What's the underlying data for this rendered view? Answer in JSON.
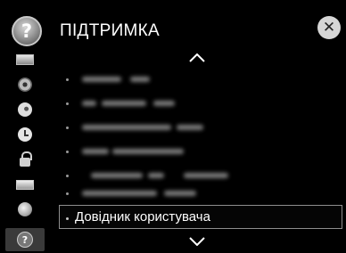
{
  "header": {
    "title": "ПІДТРИМКА",
    "support_glyph": "?",
    "close_glyph": "✕"
  },
  "sidebar": {
    "items": [
      {
        "icon": "picture-icon"
      },
      {
        "icon": "sound-icon"
      },
      {
        "icon": "channel-icon"
      },
      {
        "icon": "time-icon"
      },
      {
        "icon": "lock-icon"
      },
      {
        "icon": "option-icon"
      },
      {
        "icon": "network-icon"
      },
      {
        "icon": "support-icon",
        "glyph": "?",
        "selected": true
      }
    ]
  },
  "menu": {
    "items": [
      {
        "label": "",
        "blurred": true
      },
      {
        "label": "",
        "blurred": true
      },
      {
        "label": "",
        "blurred": true
      },
      {
        "label": "",
        "blurred": true
      },
      {
        "label": "",
        "blurred": true
      },
      {
        "label": "",
        "blurred": true
      },
      {
        "label": "Довідник користувача",
        "blurred": false,
        "selected": true
      }
    ]
  },
  "colors": {
    "background": "#000000",
    "text": "#ffffff",
    "selection_border": "#8e8e8e"
  }
}
